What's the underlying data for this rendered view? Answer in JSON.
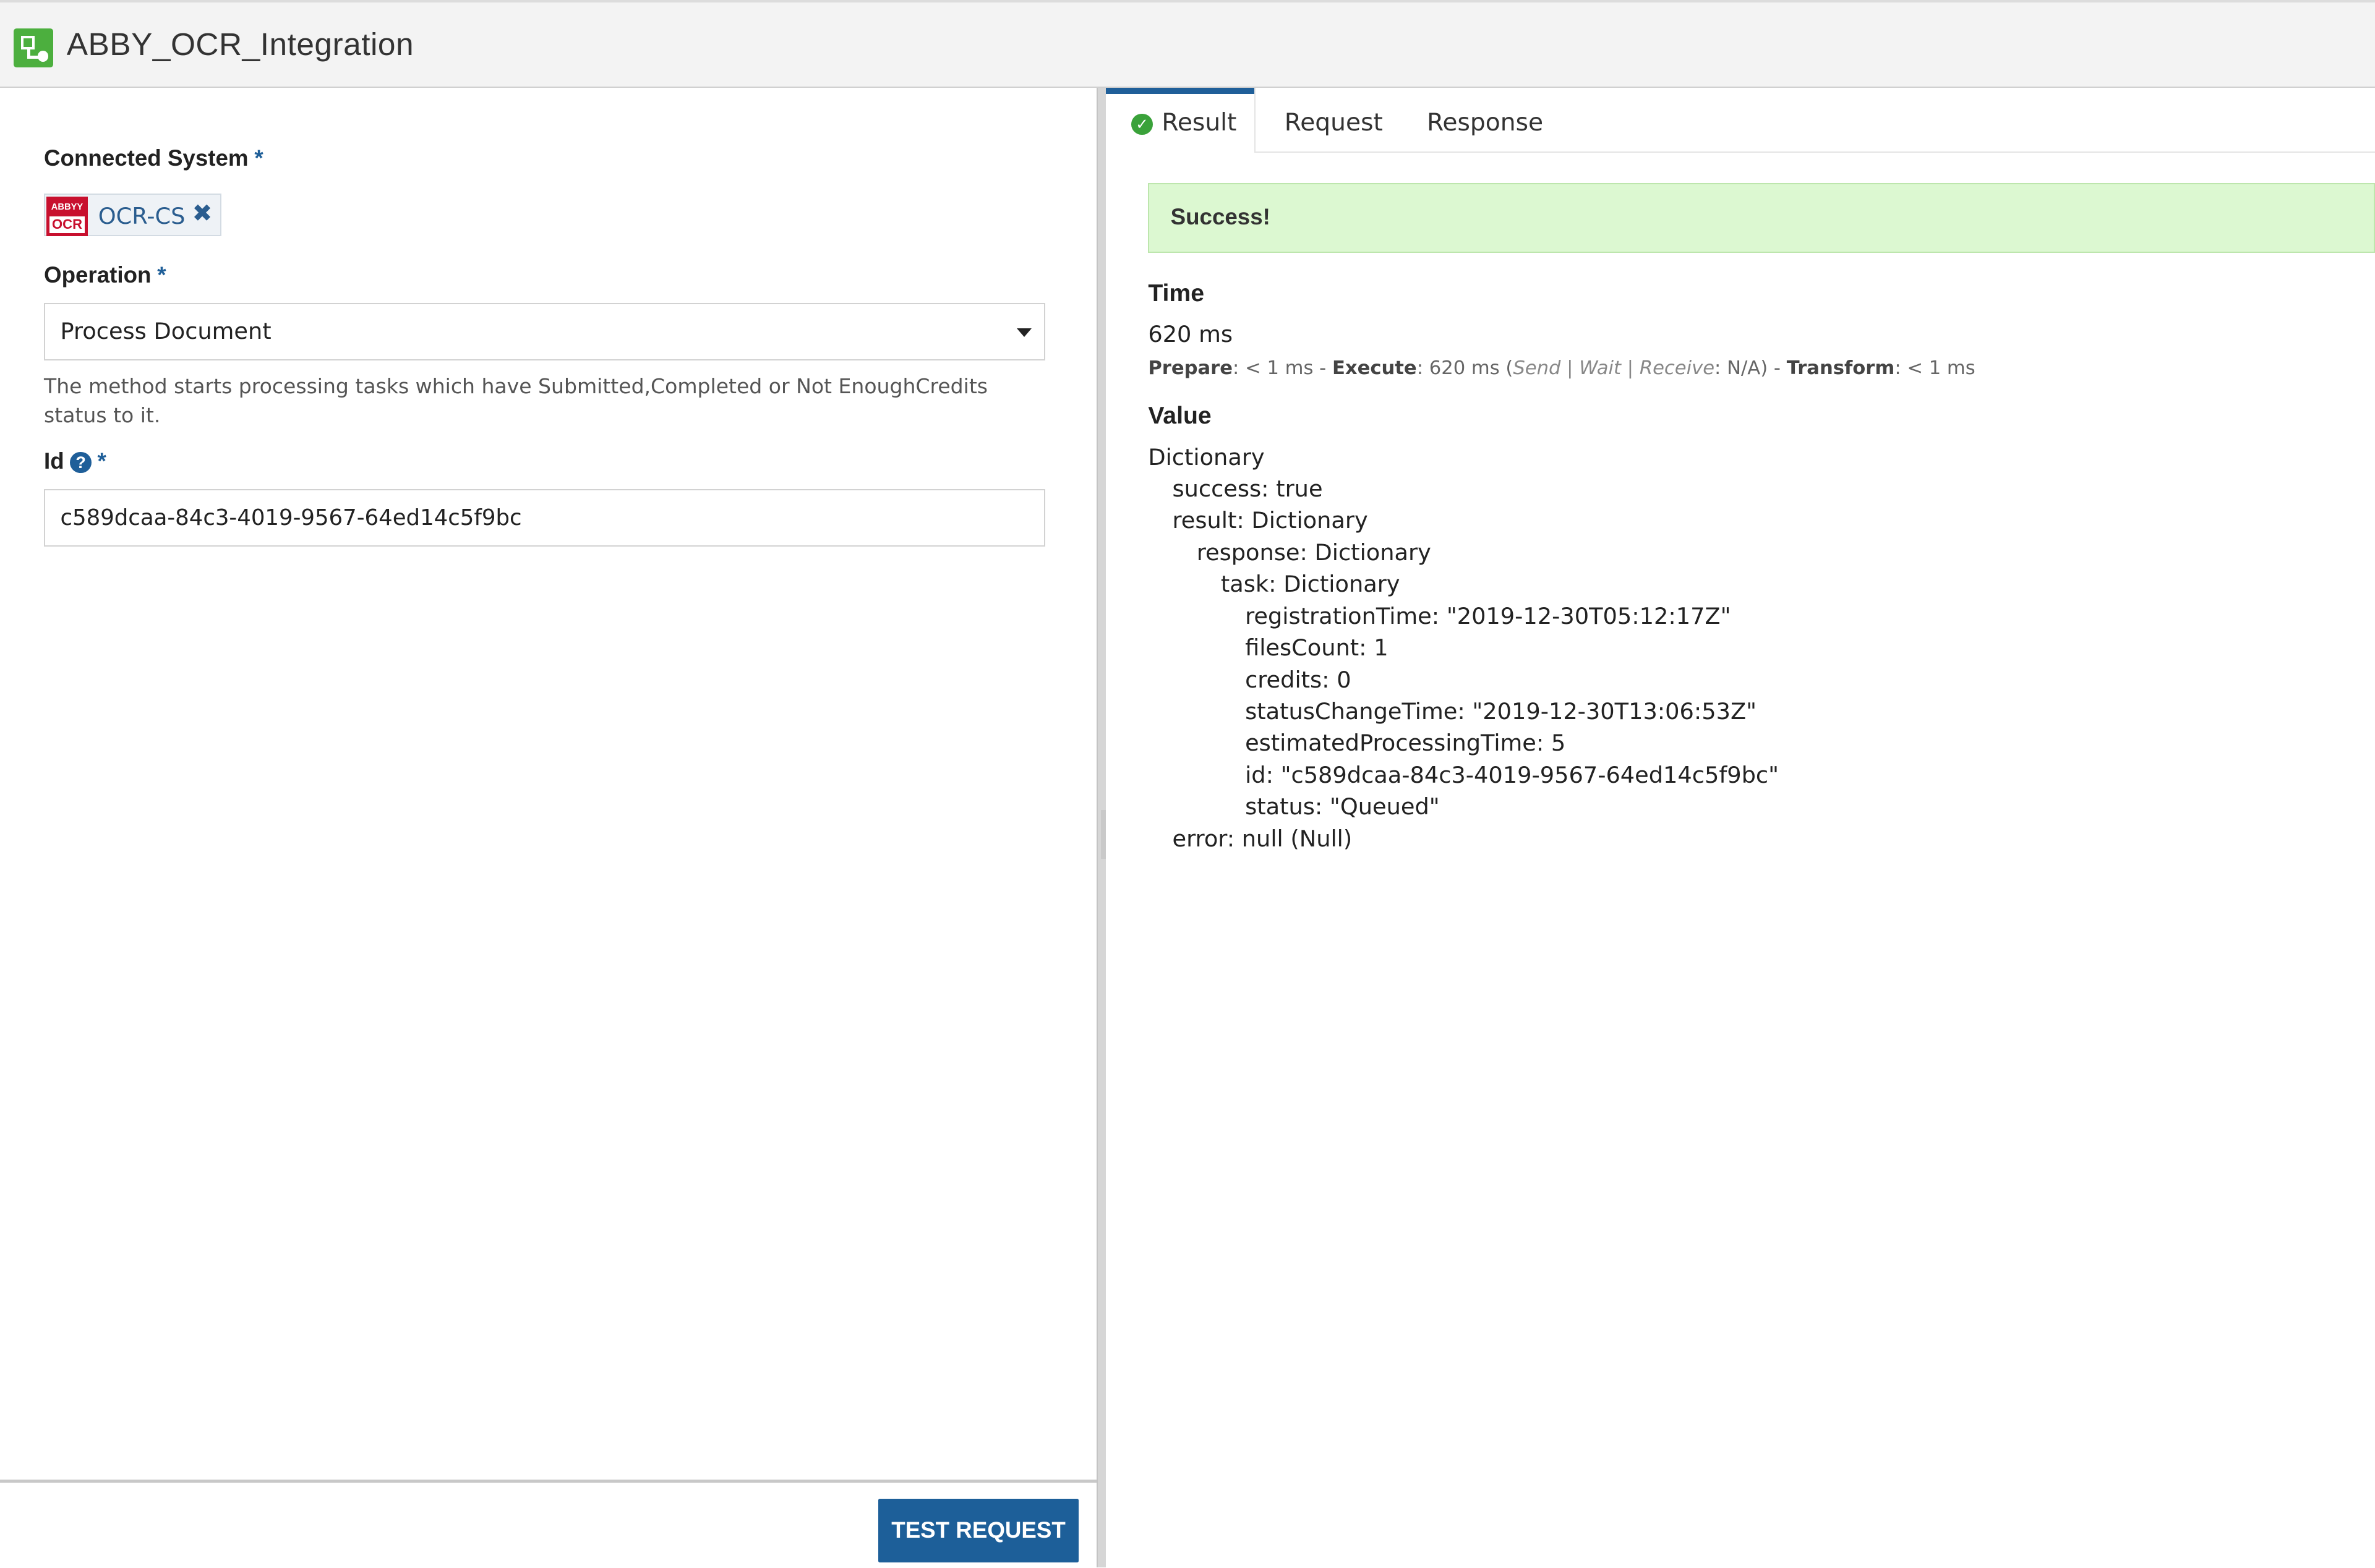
{
  "app": {
    "title": "ABBY_OCR_Integration",
    "icon": "integration-icon"
  },
  "form": {
    "connected_system": {
      "label": "Connected System",
      "required_mark": "*",
      "chip_label": "OCR-CS",
      "chip_logo_top": "ABBYY",
      "chip_logo_bottom": "OCR",
      "remove_icon": "close-icon"
    },
    "operation": {
      "label": "Operation",
      "required_mark": "*",
      "selected": "Process Document",
      "help": "The method starts processing tasks which have Submitted,Completed or Not EnoughCredits status to it."
    },
    "id_field": {
      "label": "Id",
      "help_icon": "?",
      "required_mark": "*",
      "value": "c589dcaa-84c3-4019-9567-64ed14c5f9bc"
    },
    "test_button": "TEST REQUEST"
  },
  "result_panel": {
    "tabs": [
      {
        "label": "Result",
        "active": true,
        "icon": "check-circle-icon"
      },
      {
        "label": "Request",
        "active": false
      },
      {
        "label": "Response",
        "active": false
      }
    ],
    "status_banner": "Success!",
    "status_color": "#dcf8d1",
    "time": {
      "heading": "Time",
      "value": "620 ms",
      "prepare_label": "Prepare",
      "prepare_value": ": < 1 ms - ",
      "execute_label": "Execute",
      "execute_value": ": 620 ms (",
      "execute_sub": "Send | Wait | Receive",
      "execute_sub_value": ": N/A) - ",
      "transform_label": "Transform",
      "transform_value": ": < 1 ms"
    },
    "value": {
      "heading": "Value",
      "lines": [
        {
          "indent": 0,
          "text": "Dictionary"
        },
        {
          "indent": 1,
          "text": "success: true"
        },
        {
          "indent": 1,
          "text": "result: Dictionary"
        },
        {
          "indent": 2,
          "text": "response: Dictionary"
        },
        {
          "indent": 3,
          "text": "task: Dictionary"
        },
        {
          "indent": 4,
          "text": "registrationTime: \"2019-12-30T05:12:17Z\""
        },
        {
          "indent": 4,
          "text": "filesCount: 1"
        },
        {
          "indent": 4,
          "text": "credits: 0"
        },
        {
          "indent": 4,
          "text": "statusChangeTime: \"2019-12-30T13:06:53Z\""
        },
        {
          "indent": 4,
          "text": "estimatedProcessingTime: 5"
        },
        {
          "indent": 4,
          "text": "id: \"c589dcaa-84c3-4019-9567-64ed14c5f9bc\""
        },
        {
          "indent": 4,
          "text": "status: \"Queued\""
        },
        {
          "indent": 1,
          "text": "error: null (Null)"
        }
      ]
    }
  },
  "colors": {
    "accent": "#1f5f99",
    "brand_green": "#4caf3e",
    "success_bg": "#dcf8d1"
  }
}
